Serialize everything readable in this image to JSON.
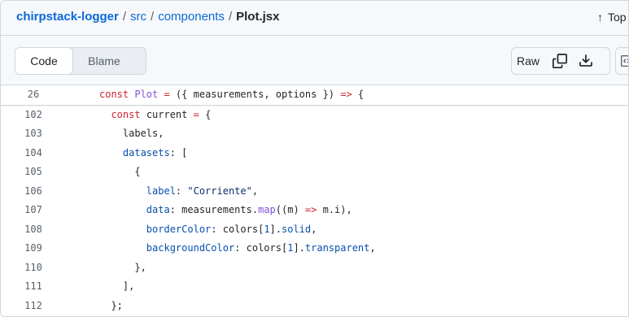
{
  "breadcrumb": {
    "repo": "chirpstack-logger",
    "separator": "/",
    "folder1": "src",
    "folder2": "components",
    "file": "Plot.jsx"
  },
  "top_link": {
    "arrow": "↑",
    "label": "Top"
  },
  "tabs": {
    "code": "Code",
    "blame": "Blame"
  },
  "actions": {
    "raw": "Raw",
    "icons": [
      "copy-icon",
      "download-icon",
      "code-embed-icon"
    ]
  },
  "colors": {
    "link": "#0969da",
    "keyword": "#cf222e",
    "function": "#8250df",
    "property": "#0550ae",
    "string": "#0a3069",
    "line_number": "#57606a"
  },
  "code_lines": [
    {
      "number": "26",
      "tokens": [
        {
          "t": "kw",
          "v": "const "
        },
        {
          "t": "fn",
          "v": "Plot"
        },
        {
          "t": "kw",
          "v": " = "
        },
        {
          "t": "plain",
          "v": "({ measurements, options }) "
        },
        {
          "t": "kw",
          "v": "=>"
        },
        {
          "t": "plain",
          "v": " {"
        }
      ]
    },
    {
      "number": "102",
      "tokens": [
        {
          "t": "plain",
          "v": "  "
        },
        {
          "t": "kw",
          "v": "const "
        },
        {
          "t": "plain",
          "v": "current "
        },
        {
          "t": "kw",
          "v": "="
        },
        {
          "t": "plain",
          "v": " {"
        }
      ]
    },
    {
      "number": "103",
      "tokens": [
        {
          "t": "plain",
          "v": "    labels,"
        }
      ]
    },
    {
      "number": "104",
      "tokens": [
        {
          "t": "plain",
          "v": "    "
        },
        {
          "t": "prop",
          "v": "datasets"
        },
        {
          "t": "plain",
          "v": ": ["
        }
      ]
    },
    {
      "number": "105",
      "tokens": [
        {
          "t": "plain",
          "v": "      {"
        }
      ]
    },
    {
      "number": "106",
      "tokens": [
        {
          "t": "plain",
          "v": "        "
        },
        {
          "t": "prop",
          "v": "label"
        },
        {
          "t": "plain",
          "v": ": "
        },
        {
          "t": "str",
          "v": "\"Corriente\""
        },
        {
          "t": "plain",
          "v": ","
        }
      ]
    },
    {
      "number": "107",
      "tokens": [
        {
          "t": "plain",
          "v": "        "
        },
        {
          "t": "prop",
          "v": "data"
        },
        {
          "t": "plain",
          "v": ": measurements."
        },
        {
          "t": "fn",
          "v": "map"
        },
        {
          "t": "plain",
          "v": "((m) "
        },
        {
          "t": "kw",
          "v": "=>"
        },
        {
          "t": "plain",
          "v": " m.i),"
        }
      ]
    },
    {
      "number": "108",
      "tokens": [
        {
          "t": "plain",
          "v": "        "
        },
        {
          "t": "prop",
          "v": "borderColor"
        },
        {
          "t": "plain",
          "v": ": colors["
        },
        {
          "t": "prop",
          "v": "1"
        },
        {
          "t": "plain",
          "v": "]."
        },
        {
          "t": "prop",
          "v": "solid"
        },
        {
          "t": "plain",
          "v": ","
        }
      ]
    },
    {
      "number": "109",
      "tokens": [
        {
          "t": "plain",
          "v": "        "
        },
        {
          "t": "prop",
          "v": "backgroundColor"
        },
        {
          "t": "plain",
          "v": ": colors["
        },
        {
          "t": "prop",
          "v": "1"
        },
        {
          "t": "plain",
          "v": "]."
        },
        {
          "t": "prop",
          "v": "transparent"
        },
        {
          "t": "plain",
          "v": ","
        }
      ]
    },
    {
      "number": "110",
      "tokens": [
        {
          "t": "plain",
          "v": "      },"
        }
      ]
    },
    {
      "number": "111",
      "tokens": [
        {
          "t": "plain",
          "v": "    ],"
        }
      ]
    },
    {
      "number": "112",
      "tokens": [
        {
          "t": "plain",
          "v": "  };"
        }
      ]
    }
  ]
}
